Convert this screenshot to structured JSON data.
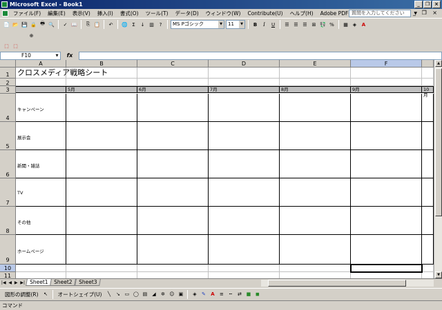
{
  "window": {
    "title": "Microsoft Excel - Book1"
  },
  "menu": {
    "items": [
      "ファイル(F)",
      "編集(E)",
      "表示(V)",
      "挿入(I)",
      "書式(O)",
      "ツール(T)",
      "データ(D)",
      "ウィンドウ(W)",
      "Contribute(U)",
      "ヘルプ(H)",
      "Adobe PDF(B)"
    ]
  },
  "help": {
    "placeholder": "質問を入力してください"
  },
  "toolbar": {
    "font_name": "MS Pゴシック",
    "font_size": "11",
    "bold": "B",
    "italic": "I",
    "underline": "U",
    "sum": "Σ",
    "percent": "%"
  },
  "formula_bar": {
    "name_box": "F10",
    "fx": "fx",
    "content": ""
  },
  "sheet": {
    "columns": [
      "A",
      "B",
      "C",
      "D",
      "E",
      "F"
    ],
    "rows": [
      "1",
      "2",
      "3",
      "4",
      "5",
      "6",
      "7",
      "8",
      "9",
      "10",
      "11"
    ],
    "title": "クロスメディア戦略シート",
    "months": [
      "5月",
      "6月",
      "7月",
      "8月",
      "9月",
      "10月"
    ],
    "categories": [
      "キャンペーン",
      "展示会",
      "新聞・雑誌",
      "TV",
      "その他",
      "ホームページ"
    ],
    "selected_cell": "F10"
  },
  "tabs": [
    "Sheet1",
    "Sheet2",
    "Sheet3"
  ],
  "drawing": {
    "draw_menu": "図形の調整(R)",
    "autoshape": "オートシェイプ(U)"
  },
  "status": {
    "text": "コマンド"
  }
}
